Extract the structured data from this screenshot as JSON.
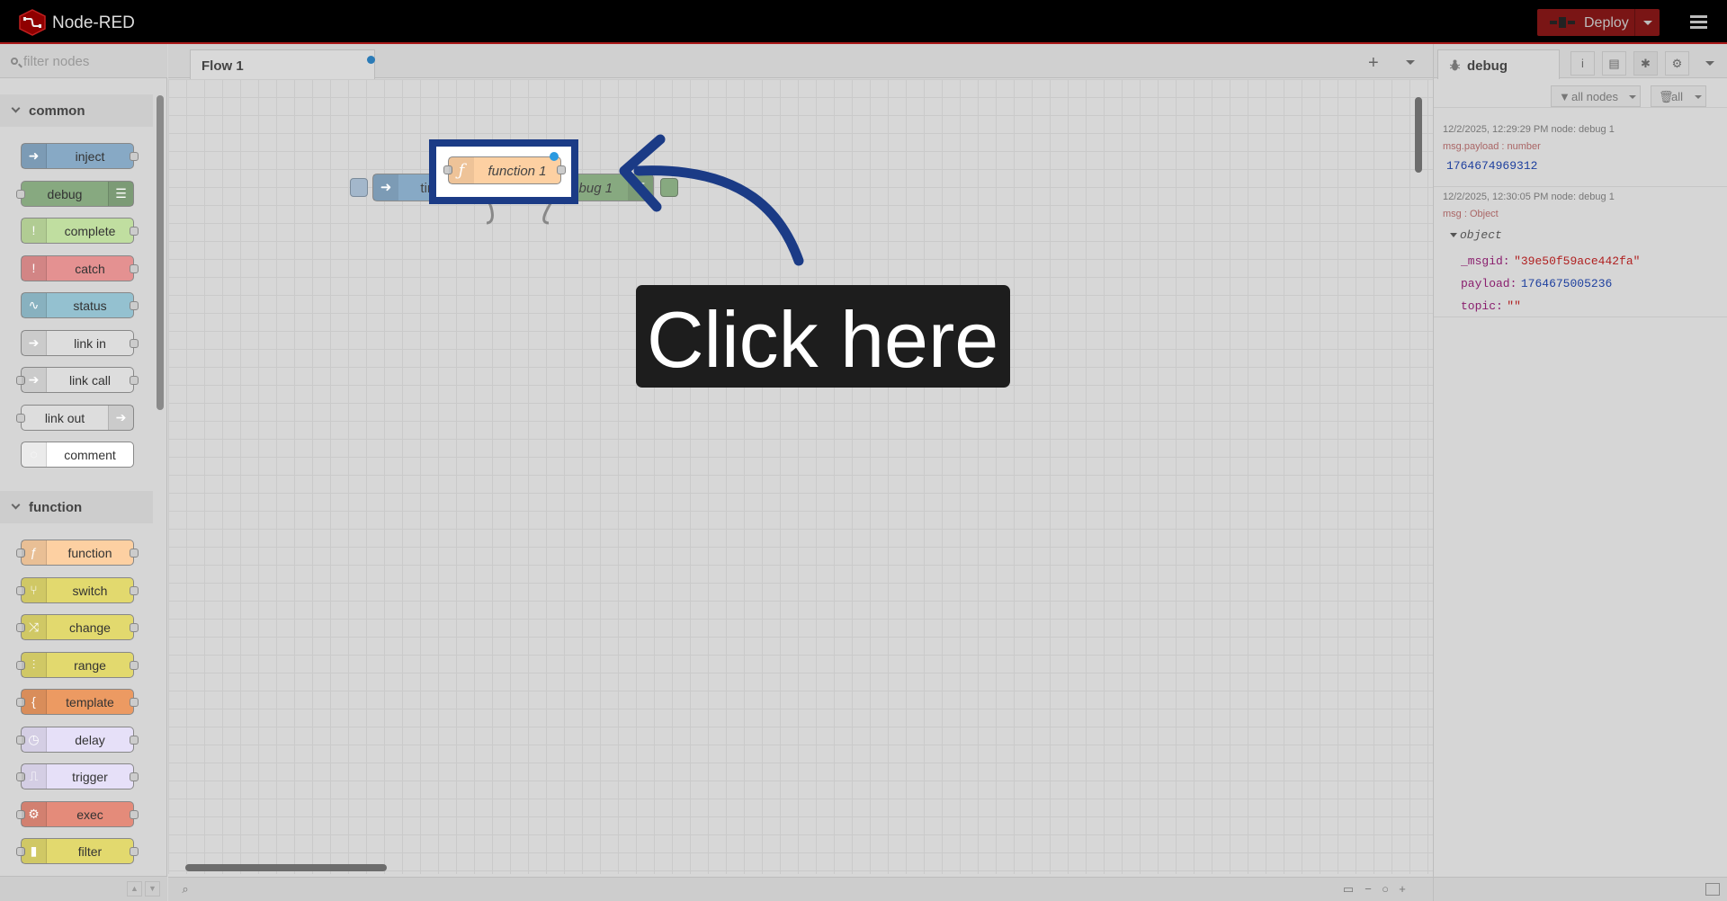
{
  "header": {
    "app_title": "Node-RED",
    "deploy_label": "Deploy",
    "logo_icon": "node-red-logo-icon",
    "menu_icon": "hamburger-menu-icon",
    "colors": {
      "bar": "#000000",
      "accent": "#aa1a1a",
      "deploy": "#7a1515"
    }
  },
  "palette": {
    "search_placeholder": "filter nodes",
    "categories": [
      {
        "label": "common",
        "nodes": [
          {
            "label": "inject",
            "color": "#87a9c5",
            "icon": "arrow-in-icon",
            "icon_side": "left",
            "ports": "right"
          },
          {
            "label": "debug",
            "color": "#87a980",
            "icon": "list-icon",
            "icon_side": "right",
            "ports": "left"
          },
          {
            "label": "complete",
            "color": "#c0dea0",
            "icon": "exclamation-icon",
            "icon_side": "left",
            "ports": "right"
          },
          {
            "label": "catch",
            "color": "#e49191",
            "icon": "exclamation-icon",
            "icon_side": "left",
            "ports": "right"
          },
          {
            "label": "status",
            "color": "#94c1d0",
            "icon": "pulse-icon",
            "icon_side": "left",
            "ports": "right"
          },
          {
            "label": "link in",
            "color": "#dddddd",
            "icon": "link-arrow-icon",
            "icon_side": "left",
            "ports": "right"
          },
          {
            "label": "link call",
            "color": "#dddddd",
            "icon": "link-arrow-icon",
            "icon_side": "left",
            "ports": "both"
          },
          {
            "label": "link out",
            "color": "#dddddd",
            "icon": "link-arrow-icon",
            "icon_side": "right",
            "ports": "left"
          },
          {
            "label": "comment",
            "color": "#ffffff",
            "icon": "speech-bubble-icon",
            "icon_side": "left",
            "ports": "none"
          }
        ]
      },
      {
        "label": "function",
        "nodes": [
          {
            "label": "function",
            "color": "#fdd0a2",
            "icon": "function-icon",
            "icon_side": "left",
            "ports": "both"
          },
          {
            "label": "switch",
            "color": "#e2d96e",
            "icon": "switch-icon",
            "icon_side": "left",
            "ports": "both"
          },
          {
            "label": "change",
            "color": "#e2d96e",
            "icon": "shuffle-icon",
            "icon_side": "left",
            "ports": "both"
          },
          {
            "label": "range",
            "color": "#e2d96e",
            "icon": "range-icon",
            "icon_side": "left",
            "ports": "both"
          },
          {
            "label": "template",
            "color": "#ec9a62",
            "icon": "curly-brace-icon",
            "icon_side": "left",
            "ports": "both"
          },
          {
            "label": "delay",
            "color": "#e6e0f8",
            "icon": "timer-icon",
            "icon_side": "left",
            "ports": "both"
          },
          {
            "label": "trigger",
            "color": "#e6e0f8",
            "icon": "trigger-icon",
            "icon_side": "left",
            "ports": "both"
          },
          {
            "label": "exec",
            "color": "#e48b7a",
            "icon": "gear-icon",
            "icon_side": "left",
            "ports": "both"
          },
          {
            "label": "filter",
            "color": "#e2d96e",
            "icon": "filter-icon",
            "icon_side": "left",
            "ports": "both"
          }
        ]
      }
    ]
  },
  "workspace": {
    "tab_label": "Flow 1",
    "add_flow_label": "+",
    "nodes": {
      "function": {
        "label": "function 1",
        "color": "#fdd0a2",
        "icon": "function-icon"
      },
      "timestamp": {
        "label": "timestamp",
        "color": "#87a9c5",
        "icon": "arrow-in-icon"
      },
      "debug": {
        "label": "debug 1",
        "color": "#87a980",
        "icon": "list-icon"
      }
    }
  },
  "sidebar": {
    "tab_label": "debug",
    "tab_icon": "bug-icon",
    "buttons": [
      "info-icon",
      "book-icon",
      "bug-icon",
      "gear-icon"
    ],
    "filter_label": "all nodes",
    "clear_label": "all",
    "messages": [
      {
        "meta": "12/2/2025, 12:29:29 PM   node: debug 1",
        "topic": "msg.payload : number",
        "value": "1764674969312"
      },
      {
        "meta": "12/2/2025, 12:30:05 PM   node: debug 1",
        "topic": "msg : Object",
        "object_label": "object",
        "fields": [
          {
            "key": "_msgid:",
            "value": "\"39e50f59ace442fa\""
          },
          {
            "key": "payload:",
            "value": "1764675005236"
          },
          {
            "key": "topic:",
            "value": "\"\""
          }
        ]
      }
    ]
  },
  "overlay": {
    "tooltip_text": "Click here",
    "highlight_color": "#1b3b86",
    "arrow_color": "#1b3b86"
  }
}
